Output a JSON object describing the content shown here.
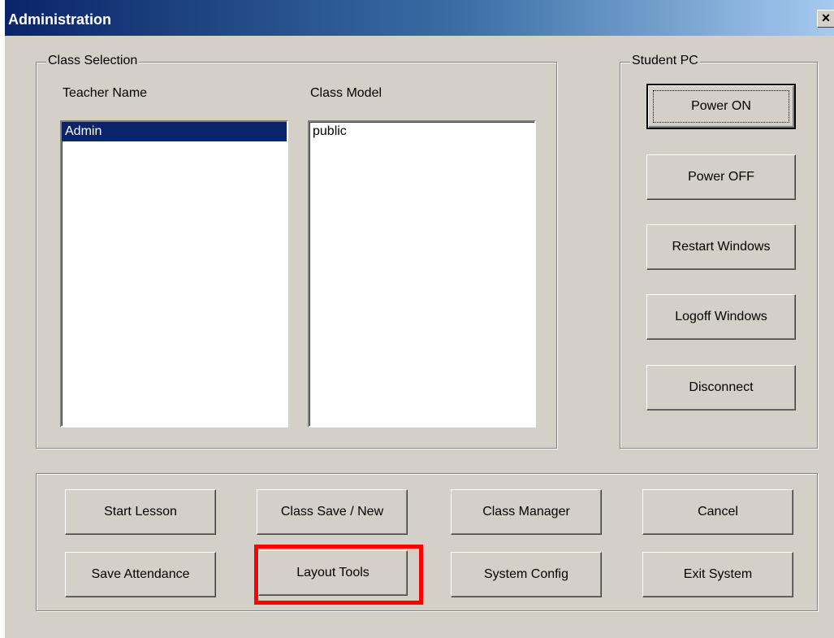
{
  "window": {
    "title": "Administration",
    "close_label": "×"
  },
  "class_selection": {
    "legend": "Class Selection",
    "teacher_header": "Teacher Name",
    "model_header": "Class Model",
    "teachers": [
      "Admin"
    ],
    "selected_teacher": "Admin",
    "models": [
      "public"
    ]
  },
  "student_pc": {
    "legend": "Student PC",
    "buttons": [
      "Power ON",
      "Power OFF",
      "Restart Windows",
      "Logoff Windows",
      "Disconnect"
    ]
  },
  "actions": {
    "start_lesson": "Start Lesson",
    "class_save_new": "Class Save / New",
    "class_manager": "Class Manager",
    "cancel": "Cancel",
    "save_attendance": "Save Attendance",
    "layout_tools": "Layout Tools",
    "system_config": "System Config",
    "exit_system": "Exit System"
  },
  "colors": {
    "highlight": "#ff0000",
    "selection": "#0a246a",
    "title_bar": "#0a246a"
  }
}
